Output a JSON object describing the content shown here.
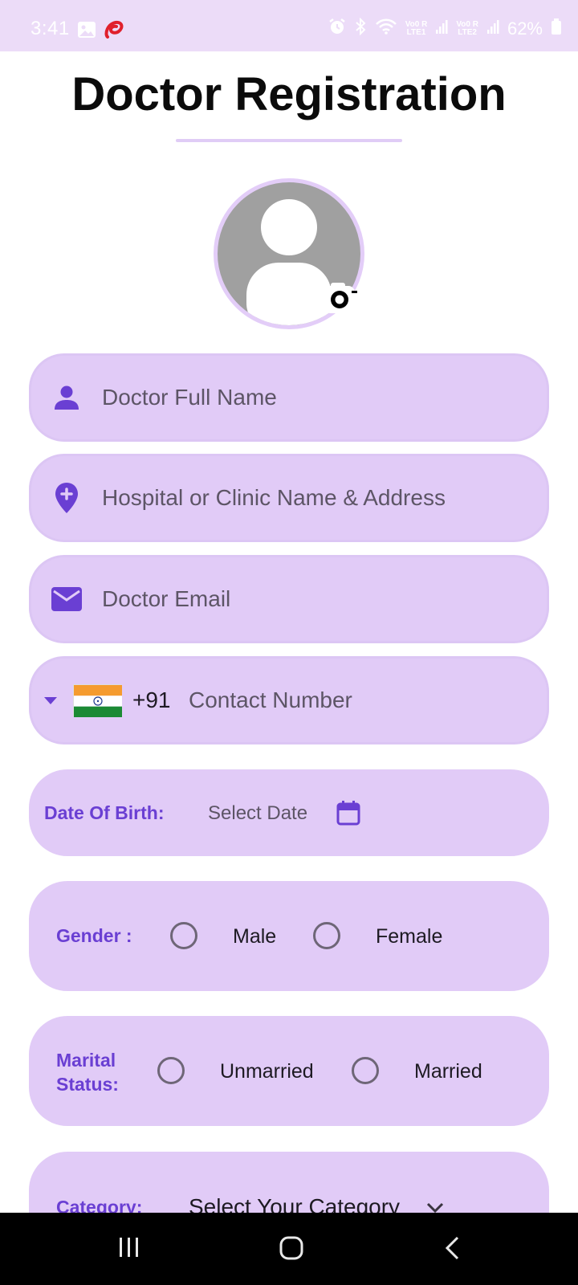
{
  "status_bar": {
    "time": "3:41",
    "battery": "62%",
    "icons": [
      "gallery-icon",
      "airtel-icon",
      "alarm-icon",
      "bluetooth-icon",
      "wifi-icon",
      "signal-icon",
      "battery-icon"
    ],
    "sim1_label": "Vo0 R\nLTE1",
    "sim2_label": "Vo0 R\nLTE2"
  },
  "header": {
    "title": "Doctor Registration"
  },
  "form": {
    "full_name_placeholder": "Doctor Full Name",
    "hospital_placeholder": "Hospital or Clinic Name & Address",
    "email_placeholder": "Doctor Email",
    "phone": {
      "country_code": "+91",
      "placeholder": "Contact Number",
      "flag": "india-flag"
    },
    "dob": {
      "label": "Date Of Birth:",
      "value": "Select Date"
    },
    "gender": {
      "label": "Gender :",
      "options": [
        "Male",
        "Female"
      ],
      "selected": null
    },
    "marital_status": {
      "label_line1": "Marital",
      "label_line2": "Status:",
      "options": [
        "Unmarried",
        "Married"
      ],
      "selected": null
    },
    "category": {
      "label": "Category:",
      "value": "Select Your Category"
    }
  },
  "colors": {
    "field_bg": "#e1cbf7",
    "accent": "#6a3fd3",
    "status_bar_bg": "#ecdcf8",
    "nav_bar_bg": "#000000"
  }
}
